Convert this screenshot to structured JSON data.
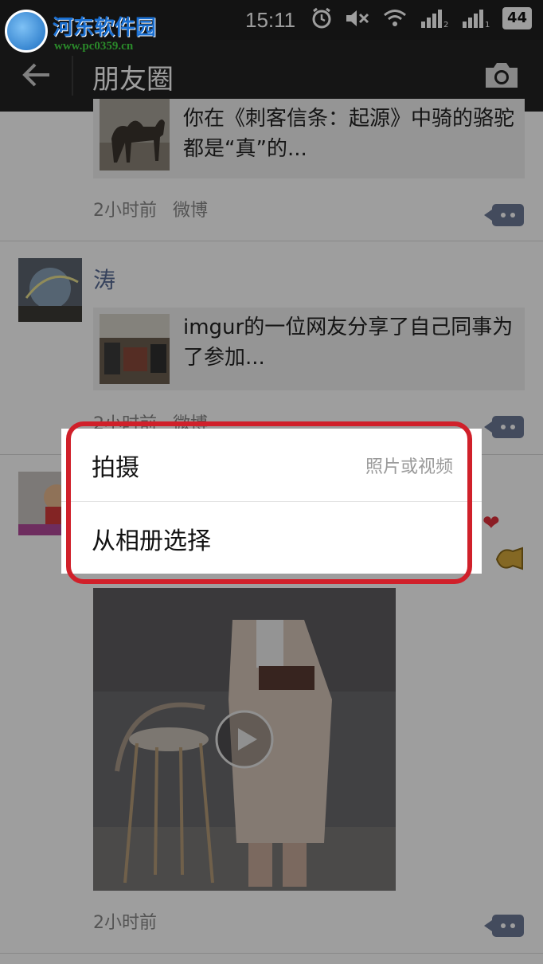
{
  "status_bar": {
    "time": "15:11",
    "battery": "44"
  },
  "watermark": {
    "title": "河东软件园",
    "url": "www.pc0359.cn"
  },
  "navbar": {
    "title": "朋友圈",
    "back_icon": "arrow-left-icon",
    "camera_icon": "camera-icon"
  },
  "feed": {
    "post1": {
      "share_text": "你在《刺客信条：起源》中骑的骆驼都是“真”的...",
      "time": "2小时前",
      "source": "微博"
    },
    "post2": {
      "username": "涛",
      "share_text": "imgur的一位网友分享了自己同事为了参加...",
      "time": "2小时前",
      "source": "微博"
    },
    "post3": {
      "time": "2小时前"
    }
  },
  "dialog": {
    "item1": {
      "label": "拍摄",
      "hint": "照片或视频"
    },
    "item2": {
      "label": "从相册选择"
    }
  },
  "colors": {
    "nav_bg": "#222222",
    "username": "#576b95",
    "highlight": "#d0202a"
  }
}
